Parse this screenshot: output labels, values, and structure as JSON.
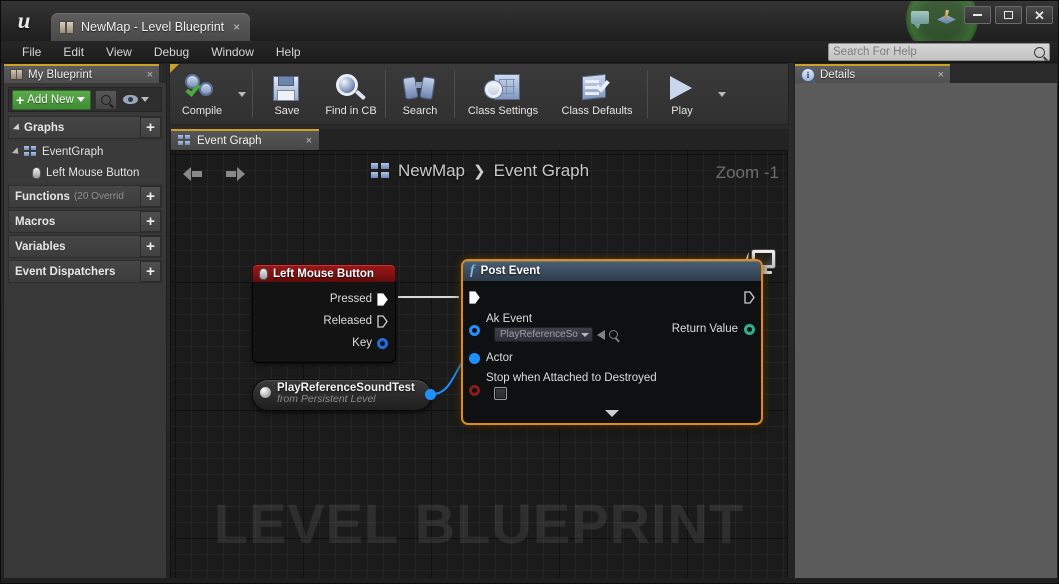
{
  "titlebar": {
    "document_tab": "NewMap - Level Blueprint",
    "tab_close": "×",
    "logo_glyph": "u",
    "window_buttons": {
      "minimize": "minimize-icon",
      "maximize": "maximize-icon",
      "close": "✕"
    },
    "feedback_icons": [
      "feedback-chat-icon",
      "tutorial-graduation-icon"
    ]
  },
  "menubar": {
    "items": [
      "File",
      "Edit",
      "View",
      "Debug",
      "Window",
      "Help"
    ]
  },
  "help_search": {
    "placeholder": "Search For Help",
    "value": ""
  },
  "my_blueprint": {
    "tab_title": "My Blueprint",
    "tab_close": "×",
    "add_new_label": "Add New",
    "sections": [
      {
        "title": "Graphs",
        "sub": "",
        "plus": "+"
      },
      {
        "title": "Functions",
        "sub": "(20 Overrid",
        "plus": "+"
      },
      {
        "title": "Macros",
        "sub": "",
        "plus": "+"
      },
      {
        "title": "Variables",
        "sub": "",
        "plus": "+"
      },
      {
        "title": "Event Dispatchers",
        "sub": "",
        "plus": "+"
      }
    ],
    "graph_tree": [
      {
        "label": "EventGraph",
        "icon": "graph-icon"
      },
      {
        "label": "Left Mouse Button",
        "icon": "mouse-icon"
      }
    ]
  },
  "toolbar": {
    "buttons": [
      {
        "label": "Compile",
        "icon": "compile-icon",
        "has_dropdown": true
      },
      {
        "label": "Save",
        "icon": "save-icon",
        "has_dropdown": false
      },
      {
        "label": "Find in CB",
        "icon": "find-in-content-browser-icon",
        "has_dropdown": false
      },
      {
        "label": "Search",
        "icon": "search-binoculars-icon",
        "has_dropdown": false
      },
      {
        "label": "Class Settings",
        "icon": "class-settings-icon",
        "has_dropdown": false
      },
      {
        "label": "Class Defaults",
        "icon": "class-defaults-icon",
        "has_dropdown": false
      },
      {
        "label": "Play",
        "icon": "play-icon",
        "has_dropdown": true
      }
    ]
  },
  "graph_tab": {
    "label": "Event Graph",
    "close": "×"
  },
  "graph": {
    "breadcrumb": {
      "root": "NewMap",
      "separator": "❯",
      "current": "Event Graph"
    },
    "zoom_label": "Zoom -1",
    "watermark": "LEVEL BLUEPRINT",
    "nav_back": "back-arrow-icon",
    "nav_forward": "forward-arrow-icon"
  },
  "nodes": {
    "left_mouse_button": {
      "title": "Left Mouse Button",
      "title_icon": "mouse-icon",
      "header_color": "#8c1414",
      "output_pins": [
        {
          "label": "Pressed",
          "type": "exec",
          "connected": true
        },
        {
          "label": "Released",
          "type": "exec",
          "connected": false
        },
        {
          "label": "Key",
          "type": "struct",
          "color": "#1f6fe0"
        }
      ]
    },
    "post_event": {
      "title": "Post Event",
      "title_icon": "function-f-icon",
      "selected": true,
      "selection_color": "#e08c12",
      "header_color": "#3c4f63",
      "exec_in": {
        "type": "exec",
        "connected": true
      },
      "exec_out": {
        "type": "exec",
        "connected": false
      },
      "inputs": [
        {
          "label": "Ak Event",
          "type": "object",
          "color": "#1e90ff",
          "widget": "dropdown",
          "widget_value": "PlayReferenceSo"
        },
        {
          "label": "Actor",
          "type": "object",
          "color": "#1e90ff",
          "connected": true
        },
        {
          "label": "Stop when Attached to Destroyed",
          "type": "bool",
          "color": "#8b1a1a",
          "widget": "checkbox",
          "checked": false
        }
      ],
      "outputs": [
        {
          "label": "Return Value",
          "type": "int",
          "color": "#2fb18a"
        }
      ],
      "collapse_arrow": "chevron-down-icon",
      "badge_icons": [
        "lightning-bolt-icon",
        "monitor-icon"
      ]
    },
    "play_reference_sound_test": {
      "title": "PlayReferenceSoundTest",
      "subtitle": "from Persistent Level",
      "output_pin": {
        "type": "object",
        "color": "#1e90ff",
        "connected": true
      }
    }
  },
  "details_panel": {
    "tab_title": "Details",
    "tab_close": "×",
    "tab_icon": "info-magnifier-icon"
  },
  "colors": {
    "accent_orange": "#e08c12",
    "add_new_green": "#4f9c40",
    "tab_highlight_gold": "#c8a22a",
    "exec_wire": "#d8d8d8",
    "data_wire_blue": "#1e90ff",
    "event_node_red": "#8c1414"
  }
}
